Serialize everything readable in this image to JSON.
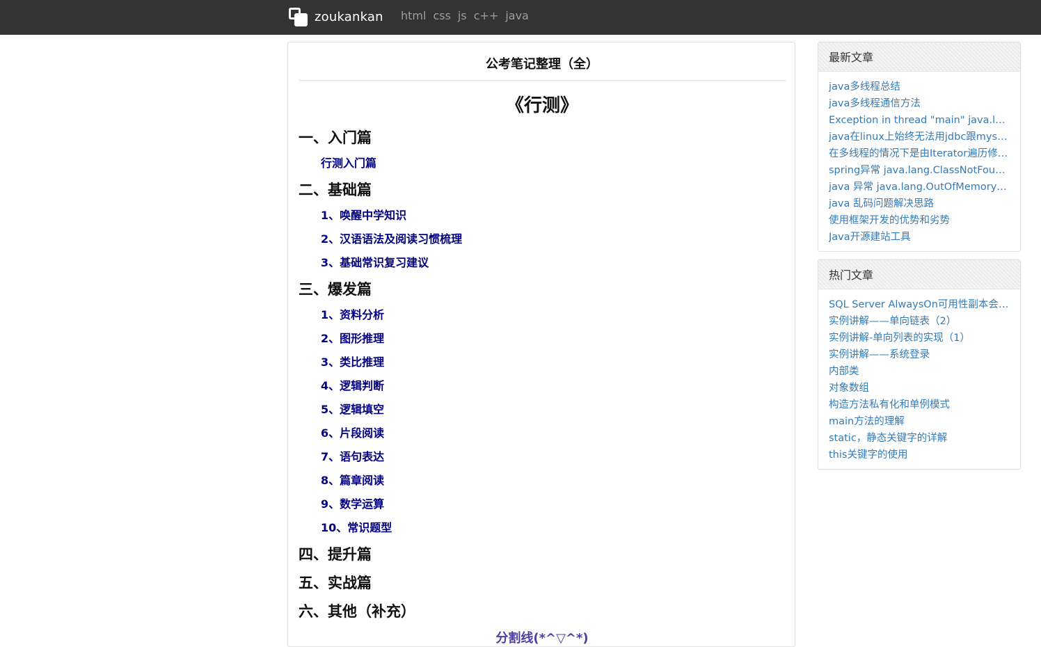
{
  "nav": {
    "brand": "zoukankan",
    "links": [
      "html",
      "css",
      "js",
      "c++",
      "java"
    ]
  },
  "article": {
    "title": "公考笔记整理（全）",
    "book_title": "《行测》",
    "sections": [
      {
        "heading": "一、入门篇",
        "items": [
          "行测入门篇"
        ]
      },
      {
        "heading": "二、基础篇",
        "items": [
          "1、唤醒中学知识",
          "2、汉语语法及阅读习惯梳理",
          "3、基础常识复习建议"
        ]
      },
      {
        "heading": "三、爆发篇",
        "items": [
          "1、资料分析",
          "2、图形推理",
          "3、类比推理",
          "4、逻辑判断",
          "5、逻辑填空",
          "6、片段阅读",
          "7、语句表达",
          "8、篇章阅读",
          "9、数学运算",
          "10、常识题型"
        ]
      },
      {
        "heading": "四、提升篇",
        "items": []
      },
      {
        "heading": "五、实战篇",
        "items": []
      },
      {
        "heading": "六、其他（补充）",
        "items": []
      }
    ],
    "divider": "分割线(*^▽^*)"
  },
  "latest": {
    "title": "最新文章",
    "items": [
      "java多线程总结",
      "java多线程通信方法",
      "Exception in thread \"main\" java.lang.ClassNotFoundException",
      "java在linux上始终无法用jdbc跟mysql连接",
      "在多线程的情况下是由Iterator遍历修改集合",
      "spring异常 java.lang.ClassNotFoundException",
      "java 异常 java.lang.OutOfMemoryError",
      "java 乱码问题解决思路",
      "使用框架开发的优势和劣势",
      "Java开源建站工具"
    ]
  },
  "hot": {
    "title": "热门文章",
    "items": [
      "SQL Server AlwaysOn可用性副本会话超时",
      "实例讲解——单向链表（2）",
      "实例讲解-单向列表的实现（1）",
      "实例讲解——系统登录",
      "内部类",
      "对象数组",
      "构造方法私有化和单例模式",
      "main方法的理解",
      "static，静态关键字的详解",
      "this关键字的使用"
    ]
  },
  "colors": {
    "topbar": "#333333",
    "link_blue": "#337ab7",
    "navy": "#000080"
  }
}
